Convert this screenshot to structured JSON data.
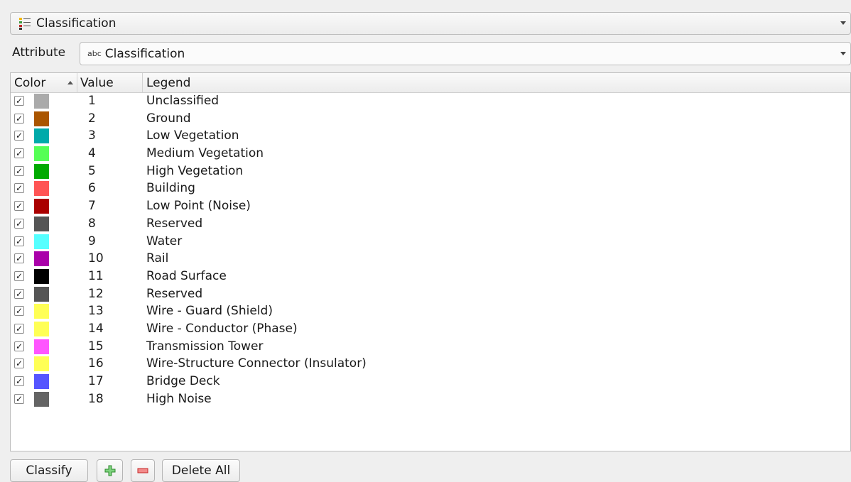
{
  "renderer": {
    "label": "Classification",
    "icon": "categorized-renderer-icon"
  },
  "attribute": {
    "label": "Attribute",
    "type_icon": "abc",
    "value": "Classification"
  },
  "table": {
    "headers": {
      "color": "Color",
      "value": "Value",
      "legend": "Legend"
    },
    "rows": [
      {
        "value": "1",
        "legend": "Unclassified",
        "color": "#aaaaaa",
        "checked": "✓"
      },
      {
        "value": "2",
        "legend": "Ground",
        "color": "#aa5500",
        "checked": "✓"
      },
      {
        "value": "3",
        "legend": "Low Vegetation",
        "color": "#00aaaa",
        "checked": "✓"
      },
      {
        "value": "4",
        "legend": "Medium Vegetation",
        "color": "#55ff55",
        "checked": "✓"
      },
      {
        "value": "5",
        "legend": "High Vegetation",
        "color": "#00aa00",
        "checked": "✓"
      },
      {
        "value": "6",
        "legend": "Building",
        "color": "#ff5555",
        "checked": "✓"
      },
      {
        "value": "7",
        "legend": "Low Point (Noise)",
        "color": "#aa0000",
        "checked": "✓"
      },
      {
        "value": "8",
        "legend": "Reserved",
        "color": "#555555",
        "checked": "✓"
      },
      {
        "value": "9",
        "legend": "Water",
        "color": "#55ffff",
        "checked": "✓"
      },
      {
        "value": "10",
        "legend": "Rail",
        "color": "#aa00aa",
        "checked": "✓"
      },
      {
        "value": "11",
        "legend": "Road Surface",
        "color": "#000000",
        "checked": "✓"
      },
      {
        "value": "12",
        "legend": "Reserved",
        "color": "#555555",
        "checked": "✓"
      },
      {
        "value": "13",
        "legend": "Wire - Guard (Shield)",
        "color": "#ffff55",
        "checked": "✓"
      },
      {
        "value": "14",
        "legend": "Wire - Conductor (Phase)",
        "color": "#ffff55",
        "checked": "✓"
      },
      {
        "value": "15",
        "legend": "Transmission Tower",
        "color": "#ff55ff",
        "checked": "✓"
      },
      {
        "value": "16",
        "legend": "Wire-Structure Connector (Insulator)",
        "color": "#ffff55",
        "checked": "✓"
      },
      {
        "value": "17",
        "legend": "Bridge Deck",
        "color": "#5555ff",
        "checked": "✓"
      },
      {
        "value": "18",
        "legend": "High Noise",
        "color": "#646464",
        "checked": "✓"
      }
    ]
  },
  "buttons": {
    "classify": "Classify",
    "add_icon": "plus-icon",
    "remove_icon": "minus-icon",
    "delete_all": "Delete All"
  }
}
